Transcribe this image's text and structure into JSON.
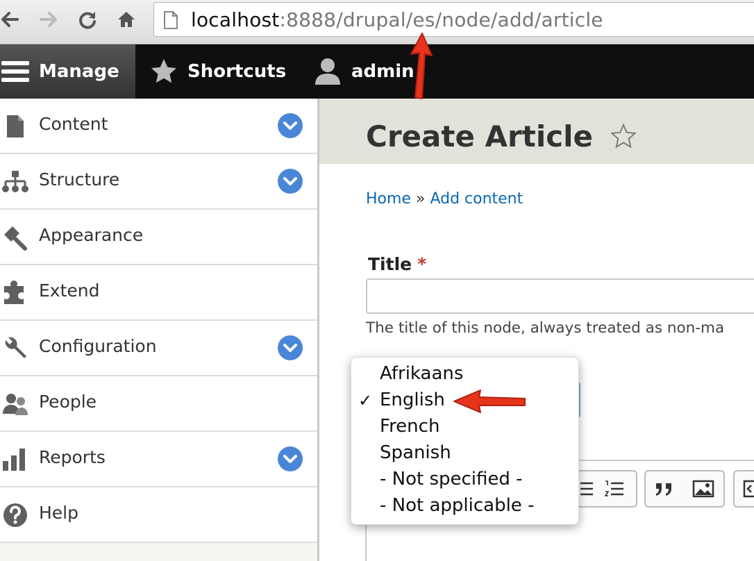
{
  "browser": {
    "url_host": "localhost",
    "url_path": ":8888/drupal/es/node/add/article"
  },
  "toolbar": {
    "manage": "Manage",
    "shortcuts": "Shortcuts",
    "user": "admin"
  },
  "sidebar": {
    "items": [
      {
        "label": "Content",
        "icon": "page-icon",
        "expandable": true
      },
      {
        "label": "Structure",
        "icon": "sitemap-icon",
        "expandable": true
      },
      {
        "label": "Appearance",
        "icon": "brush-icon",
        "expandable": false
      },
      {
        "label": "Extend",
        "icon": "puzzle-icon",
        "expandable": false
      },
      {
        "label": "Configuration",
        "icon": "wrench-icon",
        "expandable": true
      },
      {
        "label": "People",
        "icon": "people-icon",
        "expandable": false
      },
      {
        "label": "Reports",
        "icon": "bar-chart-icon",
        "expandable": true
      },
      {
        "label": "Help",
        "icon": "help-icon",
        "expandable": false
      }
    ]
  },
  "main": {
    "page_title": "Create Article",
    "breadcrumb": {
      "home": "Home",
      "separator": "»",
      "add_content": "Add content"
    },
    "title_field": {
      "label": "Title",
      "required_mark": "*",
      "value": "",
      "description": "The title of this node, always treated as non-ma"
    }
  },
  "language_dropdown": {
    "options": [
      "Afrikaans",
      "English",
      "French",
      "Spanish",
      "- Not specified -",
      "- Not applicable -"
    ],
    "selected": "English",
    "check_mark": "✓"
  },
  "colors": {
    "toolbar_bg": "#0f0f0f",
    "link": "#0a68b4",
    "toggle": "#4a86d8",
    "annotation_arrow": "#e8341c"
  }
}
